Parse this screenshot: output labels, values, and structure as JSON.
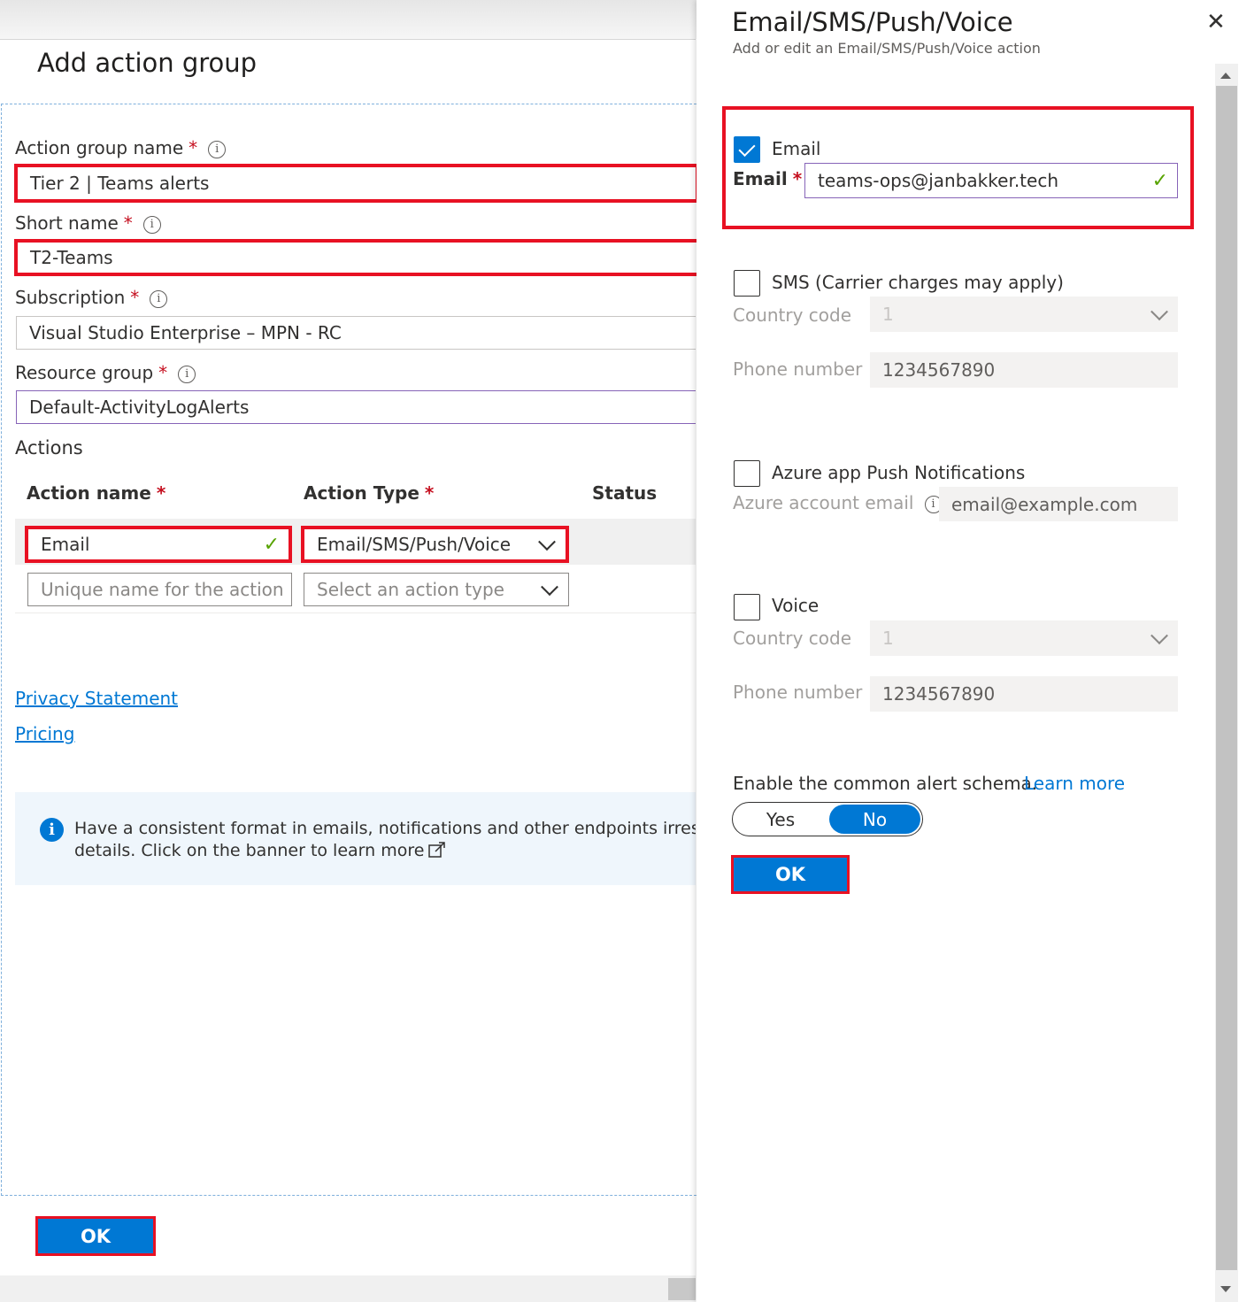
{
  "left": {
    "title": "Add action group",
    "action_group_name": {
      "label": "Action group name",
      "required": "*",
      "info": "i",
      "value": "Tier 2 | Teams alerts"
    },
    "short_name": {
      "label": "Short name",
      "required": "*",
      "info": "i",
      "value": "T2-Teams"
    },
    "subscription": {
      "label": "Subscription",
      "required": "*",
      "info": "i",
      "value": "Visual Studio Enterprise – MPN - RC"
    },
    "resource_group": {
      "label": "Resource group",
      "required": "*",
      "info": "i",
      "value": "Default-ActivityLogAlerts"
    },
    "actions": {
      "heading": "Actions",
      "columns": {
        "name": "Action name",
        "type": "Action Type",
        "status": "Status",
        "required": "*"
      },
      "rows": [
        {
          "name": "Email",
          "type": "Email/SMS/Push/Voice"
        }
      ],
      "new_row": {
        "name_placeholder": "Unique name for the action",
        "type_placeholder": "Select an action type"
      }
    },
    "links": {
      "privacy": "Privacy Statement",
      "pricing": "Pricing"
    },
    "banner": {
      "line1": "Have a consistent format in emails, notifications and other endpoints irrespective",
      "line2": "details. Click on the banner to learn more"
    },
    "ok_label": "OK"
  },
  "right": {
    "title": "Email/SMS/Push/Voice",
    "subtitle": "Add or edit an Email/SMS/Push/Voice action",
    "close": "✕",
    "email": {
      "checkbox_label": "Email",
      "checked": true,
      "field_label": "Email",
      "required": "*",
      "value": "teams-ops@janbakker.tech"
    },
    "sms": {
      "checkbox_label": "SMS (Carrier charges may apply)",
      "country_label": "Country code",
      "country_value": "1",
      "phone_label": "Phone number",
      "phone_value": "1234567890"
    },
    "push": {
      "checkbox_label": "Azure app Push Notifications",
      "account_label": "Azure account email",
      "info": "i",
      "account_placeholder": "email@example.com"
    },
    "voice": {
      "checkbox_label": "Voice",
      "country_label": "Country code",
      "country_value": "1",
      "phone_label": "Phone number",
      "phone_value": "1234567890"
    },
    "schema": {
      "label": "Enable the common alert schema.",
      "learn_more": "Learn more",
      "yes": "Yes",
      "no": "No",
      "selected": "No"
    },
    "ok_label": "OK"
  },
  "icons": [
    "info-icon",
    "checkmark-icon",
    "chevron-down-icon",
    "close-icon",
    "external-link-icon",
    "info-filled-icon"
  ],
  "colors": {
    "accent": "#0078d4",
    "highlight": "#e81123",
    "valid": "#57a300",
    "required": "#c50f1f"
  }
}
